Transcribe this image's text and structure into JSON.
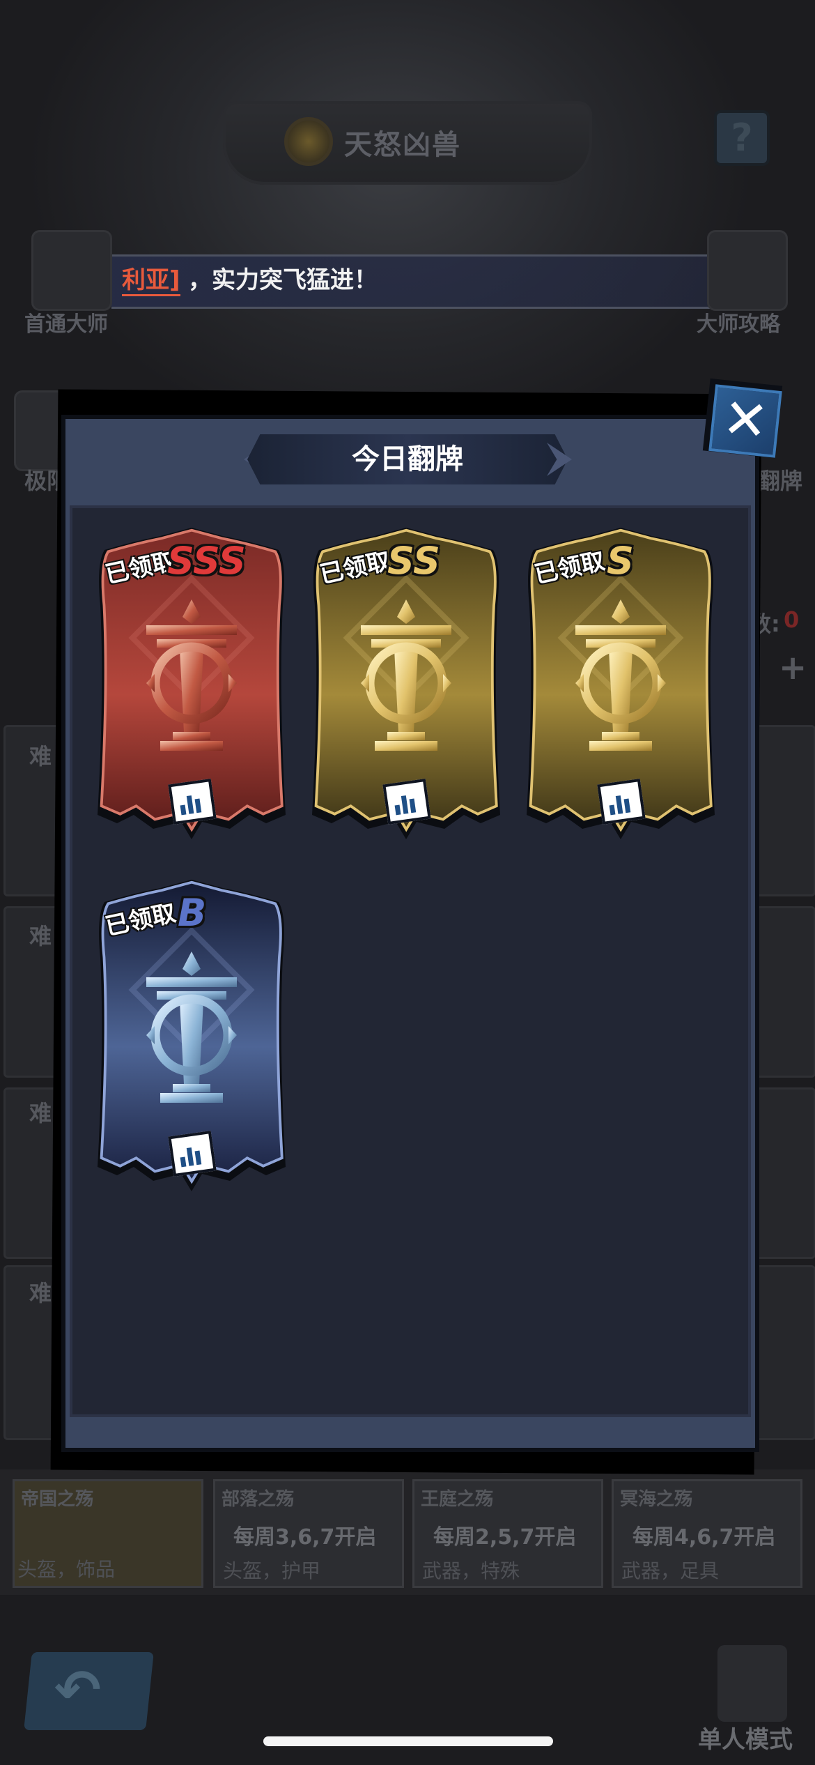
{
  "background": {
    "title": "天怒凶兽",
    "help_icon": "question-icon",
    "ticker": {
      "name": "利亚]",
      "message": "，实力突飞猛进！"
    },
    "left_buttons": [
      {
        "label": "首通大师",
        "icon": "clapperboard-icon"
      },
      {
        "label": "极限",
        "icon": "eye-icon"
      }
    ],
    "right_buttons": [
      {
        "label": "大师攻略",
        "icon": "sword-book-icon"
      },
      {
        "label": "翻牌",
        "icon": "card-icon"
      }
    ],
    "right_fragments": {
      "count_label": "数:",
      "count_value": "0",
      "plus": "+"
    },
    "rows": [
      {
        "label": "难"
      },
      {
        "label": "难"
      },
      {
        "label": "难"
      },
      {
        "label": "难"
      }
    ],
    "tabs": [
      {
        "title": "帝国之殇",
        "schedule": "",
        "items": "头盔，饰品"
      },
      {
        "title": "部落之殇",
        "schedule": "每周3,6,7开启",
        "items": "头盔，护甲"
      },
      {
        "title": "王庭之殇",
        "schedule": "每周2,5,7开启",
        "items": "武器，特殊"
      },
      {
        "title": "冥海之殇",
        "schedule": "每周4,6,7开启",
        "items": "武器，足具"
      }
    ],
    "back_icon": "back-arrow-icon",
    "mode_label": "单人模式",
    "mode_icon": "single-player-icon"
  },
  "modal": {
    "title": "今日翻牌",
    "close_icon": "close-icon",
    "cards": [
      {
        "grade": "SSS",
        "status": "已领取",
        "theme": "red",
        "icon": "trophy-icon",
        "stats_icon": "bar-chart-icon"
      },
      {
        "grade": "SS",
        "status": "已领取",
        "theme": "gold",
        "icon": "trophy-icon",
        "stats_icon": "bar-chart-icon"
      },
      {
        "grade": "S",
        "status": "已领取",
        "theme": "gold",
        "icon": "trophy-icon",
        "stats_icon": "bar-chart-icon"
      },
      {
        "grade": "B",
        "status": "已领取",
        "theme": "blue",
        "icon": "trophy-icon",
        "stats_icon": "bar-chart-icon"
      }
    ]
  },
  "colors": {
    "red_card": "#b5473c",
    "gold_card": "#a48a3a",
    "blue_card": "#4e6596",
    "grade_red": "#e03a3a",
    "grade_gold": "#e9c76c",
    "grade_blue": "#5b74c9",
    "modal_frame": "#3a4660",
    "modal_inner": "#222634"
  }
}
